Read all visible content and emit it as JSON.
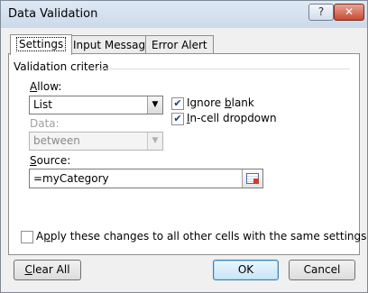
{
  "window": {
    "title": "Data Validation",
    "help_label": "?",
    "close_label": "✕"
  },
  "tabs": [
    {
      "label": "Settings",
      "active": true
    },
    {
      "label": "Input Message",
      "active": false
    },
    {
      "label": "Error Alert",
      "active": false
    }
  ],
  "group": {
    "label": "Validation criteria"
  },
  "allow": {
    "label_mnemonic": "A",
    "label_rest": "llow:",
    "value": "List"
  },
  "data": {
    "label": "Data:",
    "value": "between"
  },
  "ignore_blank": {
    "label_pre": "Ignore ",
    "label_mnemonic": "b",
    "label_post": "lank",
    "checked": true
  },
  "in_cell": {
    "label_mnemonic": "I",
    "label_post": "n-cell dropdown",
    "checked": true
  },
  "source": {
    "label_mnemonic": "S",
    "label_rest": "ource:",
    "value": "=myCategory"
  },
  "apply_all": {
    "label_pre": "A",
    "label_mnemonic": "p",
    "label_post": "ply these changes to all other cells with the same settings",
    "checked": false
  },
  "buttons": {
    "clear_mnemonic": "C",
    "clear_rest": "lear All",
    "ok_label": "OK",
    "cancel_label": "Cancel"
  },
  "icons": {
    "checkmark": "✔",
    "dropdown": "▼"
  }
}
